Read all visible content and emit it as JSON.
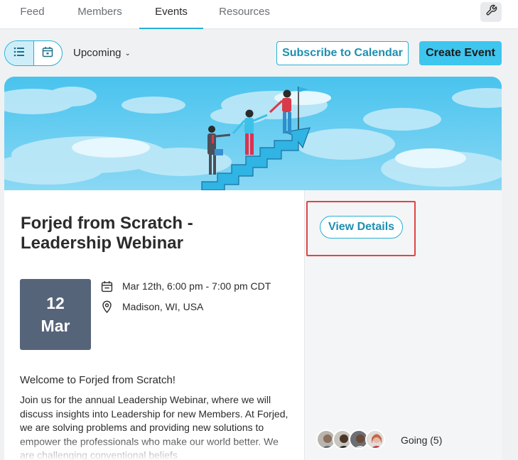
{
  "nav": {
    "tabs": [
      {
        "label": "Feed",
        "active": false
      },
      {
        "label": "Members",
        "active": false
      },
      {
        "label": "Events",
        "active": true
      },
      {
        "label": "Resources",
        "active": false
      }
    ],
    "settings_icon": "wrench-icon"
  },
  "toolbar": {
    "view_toggle": {
      "list_icon": "list-icon",
      "calendar_icon": "calendar-icon",
      "selected": "list"
    },
    "filter_label": "Upcoming",
    "subscribe_label": "Subscribe to Calendar",
    "create_label": "Create Event"
  },
  "event": {
    "title": "Forjed from Scratch - Leadership Webinar",
    "date_day": "12",
    "date_month": "Mar",
    "time": "Mar 12th, 6:00 pm - 7:00 pm CDT",
    "location": "Madison, WI, USA",
    "welcome": "Welcome to Forjed from Scratch!",
    "description": "Join us for the annual Leadership Webinar, where we will discuss insights into Leadership for new Members. At Forjed, we are solving problems and providing new solutions to empower the professionals who make our world better. We are challenging conventional beliefs",
    "view_details_label": "View Details",
    "going_label": "Going (5)"
  },
  "colors": {
    "accent": "#25b0d6",
    "primary_button": "#3ec6ee",
    "date_box": "#56647a",
    "highlight": "#e04545"
  }
}
